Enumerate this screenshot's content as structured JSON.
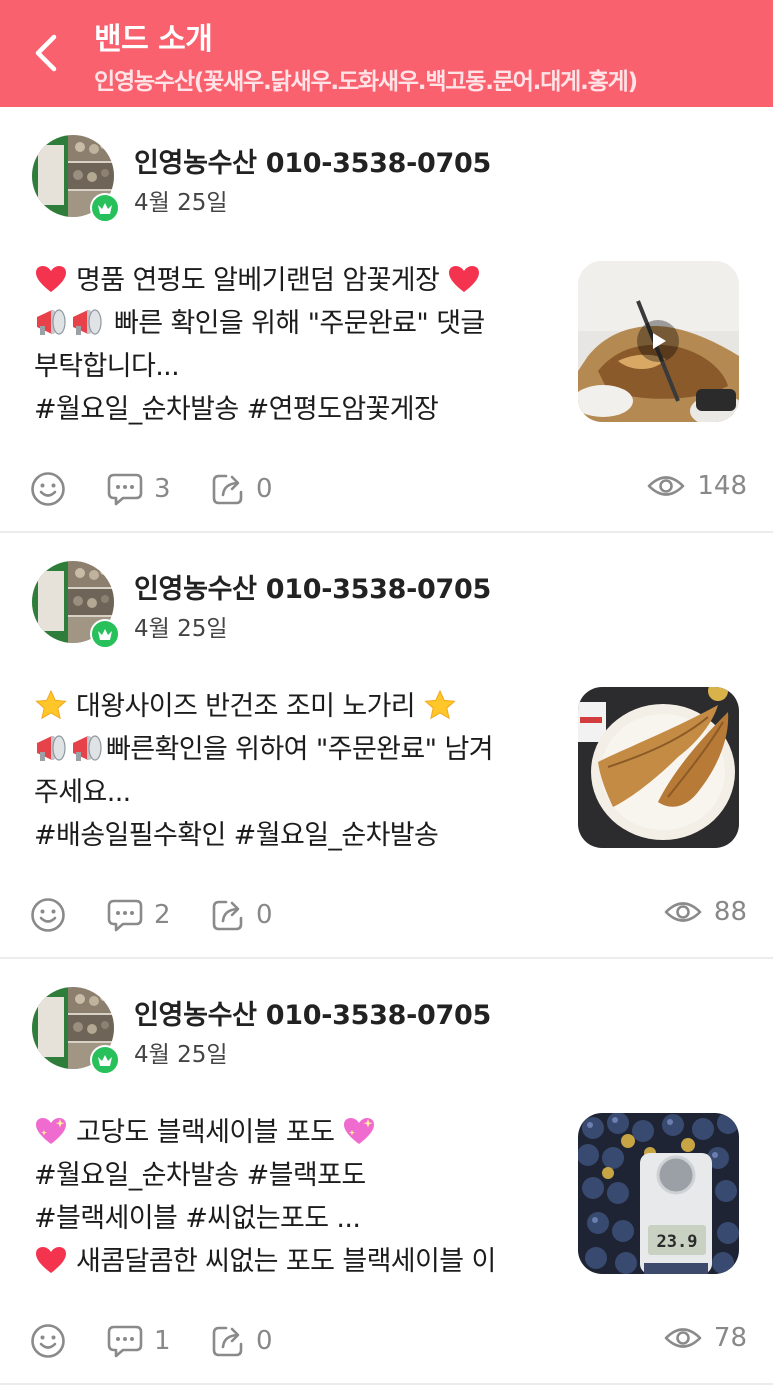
{
  "header": {
    "title": "밴드 소개",
    "subtitle": "인영농수산(꽃새우.닭새우.도화새우.백고동.문어.대게.홍게)"
  },
  "posts": [
    {
      "author": "인영농수산 010-3538-0705",
      "date": "4월 25일",
      "lines": [
        {
          "pre_emoji": "heart-red",
          "text": " 명품 연평도 알베기랜덤 암꽃게장 ",
          "post_emoji": "heart-red"
        },
        {
          "pre_emoji": "megaphones",
          "text": " 빠른 확인을 위해 \"주문완료\" 댓글",
          "post_emoji": ""
        },
        {
          "pre_emoji": "",
          "text": "부탁합니다...",
          "post_emoji": ""
        },
        {
          "pre_emoji": "",
          "text": "#월요일_순차발송 #연평도암꽃게장",
          "post_emoji": ""
        }
      ],
      "thumbnail": "crab-video",
      "has_play": true,
      "comments": "3",
      "shares": "0",
      "views": "148"
    },
    {
      "author": "인영농수산 010-3538-0705",
      "date": "4월 25일",
      "lines": [
        {
          "pre_emoji": "star",
          "text": " 대왕사이즈 반건조 조미 노가리 ",
          "post_emoji": "star"
        },
        {
          "pre_emoji": "megaphones",
          "text": "빠른확인을 위하여 \"주문완료\" 남겨",
          "post_emoji": ""
        },
        {
          "pre_emoji": "",
          "text": "주세요...",
          "post_emoji": ""
        },
        {
          "pre_emoji": "",
          "text": "#배송일필수확인 #월요일_순차발송",
          "post_emoji": ""
        }
      ],
      "thumbnail": "dried-fish",
      "has_play": false,
      "comments": "2",
      "shares": "0",
      "views": "88"
    },
    {
      "author": "인영농수산 010-3538-0705",
      "date": "4월 25일",
      "lines": [
        {
          "pre_emoji": "sparkling-heart",
          "text": " 고당도 블랙세이블 포도 ",
          "post_emoji": "sparkling-heart"
        },
        {
          "pre_emoji": "",
          "text": "#월요일_순차발송 #블랙포도",
          "post_emoji": ""
        },
        {
          "pre_emoji": "",
          "text": "#블랙세이블 #씨없는포도 ...",
          "post_emoji": ""
        },
        {
          "pre_emoji": "heart-red",
          "text": " 새콤달콤한 씨없는 포도 블랙세이블 이",
          "post_emoji": ""
        }
      ],
      "thumbnail": "grapes-refractometer",
      "refractometer_reading": "23.9",
      "has_play": false,
      "comments": "1",
      "shares": "0",
      "views": "78"
    }
  ],
  "colors": {
    "header_bg": "#f9616f",
    "badge_green": "#27c05b",
    "icon_gray": "#888888"
  },
  "icons": [
    "back-arrow-icon",
    "crown-icon",
    "smile-icon",
    "comment-icon",
    "share-icon",
    "eye-icon",
    "play-icon"
  ]
}
